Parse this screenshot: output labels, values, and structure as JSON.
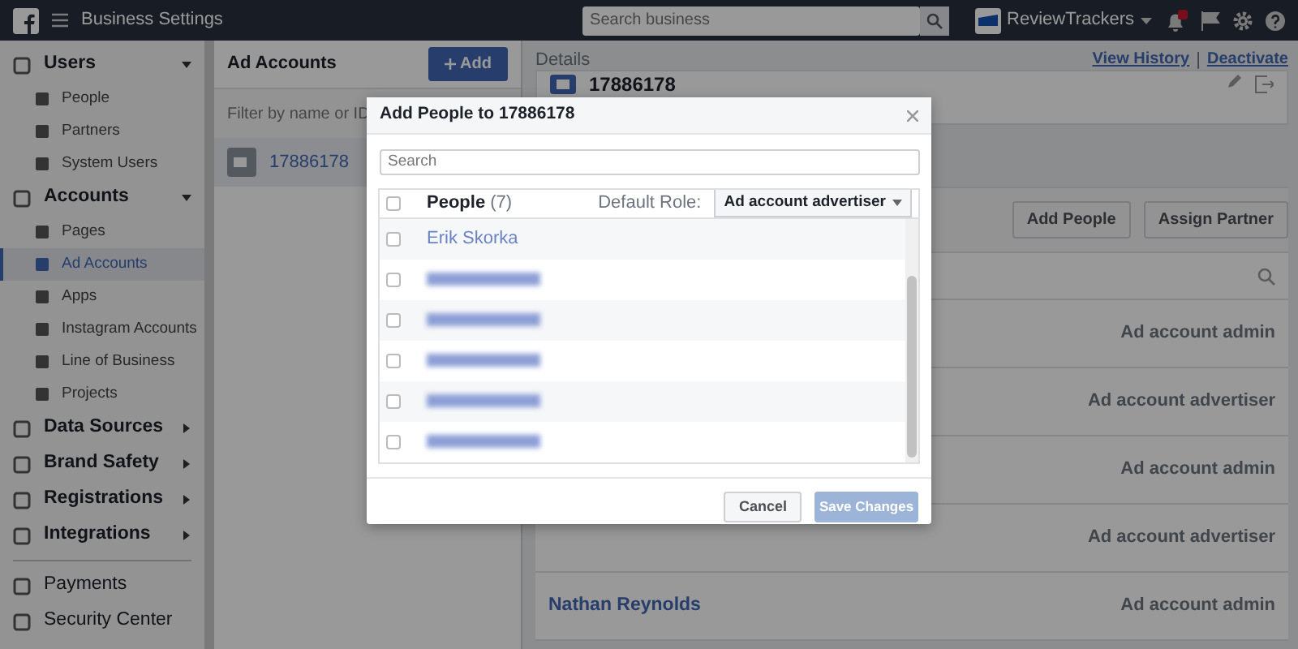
{
  "topbar": {
    "title": "Business Settings",
    "search": {
      "placeholder": "Search business"
    },
    "business": "ReviewTrackers"
  },
  "sidebar": {
    "sections": [
      {
        "label": "Users",
        "expanded": true,
        "items": [
          {
            "label": "People",
            "selected": false
          },
          {
            "label": "Partners",
            "selected": false
          },
          {
            "label": "System Users",
            "selected": false
          }
        ]
      },
      {
        "label": "Accounts",
        "expanded": true,
        "items": [
          {
            "label": "Pages",
            "selected": false
          },
          {
            "label": "Ad Accounts",
            "selected": true
          },
          {
            "label": "Apps",
            "selected": false
          },
          {
            "label": "Instagram Accounts",
            "selected": false
          },
          {
            "label": "Line of Business",
            "selected": false
          },
          {
            "label": "Projects",
            "selected": false
          }
        ]
      },
      {
        "label": "Data Sources",
        "expanded": false
      },
      {
        "label": "Brand Safety",
        "expanded": false
      },
      {
        "label": "Registrations",
        "expanded": false
      },
      {
        "label": "Integrations",
        "expanded": false
      }
    ],
    "footer_items": [
      "Payments",
      "Security Center"
    ]
  },
  "accounts_panel": {
    "title": "Ad Accounts",
    "add_button": "Add",
    "filter": {
      "placeholder": "Filter by name or ID"
    },
    "accounts": [
      {
        "name": "17886178",
        "selected": true
      }
    ]
  },
  "details": {
    "heading": "Details",
    "links": [
      "View History",
      "Deactivate"
    ],
    "link_separator": "|",
    "account_name": "17886178",
    "buttons": [
      "Add People",
      "Assign Partner"
    ],
    "people": [
      {
        "role": "Ad account admin"
      },
      {
        "role": "Ad account advertiser"
      },
      {
        "role": "Ad account admin"
      },
      {
        "role": "Ad account advertiser"
      },
      {
        "name": "Nathan Reynolds",
        "role": "Ad account admin"
      }
    ]
  },
  "dialog": {
    "title": "Add People to 17886178",
    "search": {
      "placeholder": "Search"
    },
    "select_all_checked": false,
    "column": "People",
    "count": "(7)",
    "role_label": "Default Role:",
    "role": "Ad account advertiser",
    "rows": [
      {
        "kind": "name",
        "name": "Erik Skorka",
        "checked": false
      },
      {
        "kind": "redacted",
        "checked": false
      },
      {
        "kind": "redacted",
        "checked": false
      },
      {
        "kind": "redacted",
        "checked": false
      },
      {
        "kind": "redacted",
        "checked": false
      },
      {
        "kind": "redacted",
        "checked": false
      }
    ],
    "cancel": "Cancel",
    "save": {
      "label": "Save Changes",
      "disabled": true
    }
  }
}
